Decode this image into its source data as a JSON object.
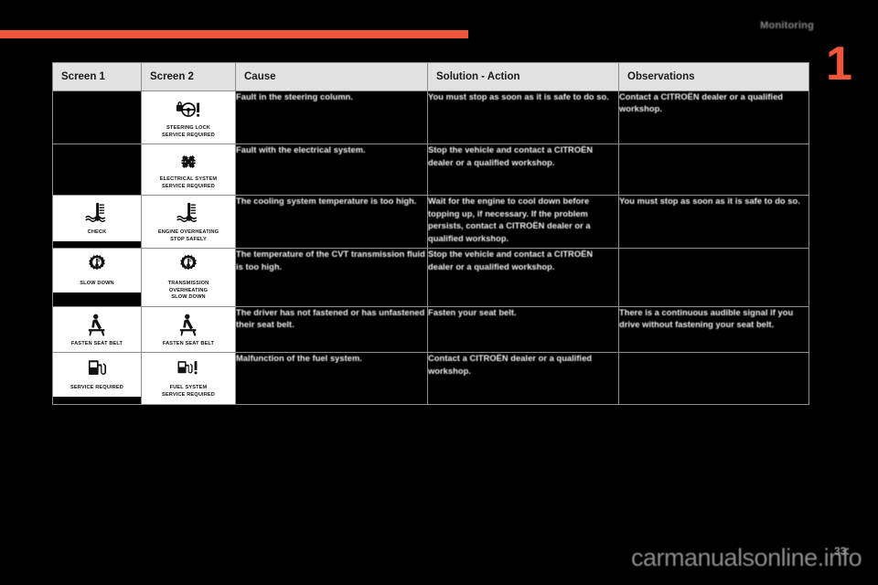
{
  "page": {
    "section_label": "Monitoring",
    "chapter_number": "1",
    "accent_color": "#F0563C",
    "header_bg": "#E2E2E2",
    "watermark": "carmanualsonline.info",
    "folio": "33"
  },
  "table": {
    "columns": [
      "Screen 1",
      "Screen 2",
      "Cause",
      "Solution - Action",
      "Observations"
    ],
    "rows": [
      {
        "screen1": null,
        "screen2": {
          "icon": "steering-lock-icon",
          "caption": "STEERING LOCK\nSERVICE REQUIRED"
        },
        "cause": "Fault in the steering column.",
        "solution": "You must stop as soon as it is safe to do so.",
        "observations": "Contact a CITROËN dealer or a qualified workshop."
      },
      {
        "screen1": null,
        "screen2": {
          "icon": "electrical-system-icon",
          "caption": "ELECTRICAL SYSTEM\nSERVICE REQUIRED"
        },
        "cause": "Fault with the electrical system.",
        "solution": "Stop the vehicle and contact a CITROËN dealer or a qualified workshop.",
        "observations": ""
      },
      {
        "screen1": {
          "icon": "coolant-temperature-icon",
          "caption": "CHECK"
        },
        "screen2": {
          "icon": "coolant-temperature-icon",
          "caption": "ENGINE OVERHEATING\nSTOP SAFELY"
        },
        "cause": "The cooling system temperature is too high.",
        "solution": "Wait for the engine to cool down before topping up, if necessary. If the problem persists, contact a CITROËN dealer or a qualified workshop.",
        "observations": "You must stop as soon as it is safe to do so."
      },
      {
        "screen1": {
          "icon": "transmission-overheating-icon",
          "caption": "SLOW DOWN"
        },
        "screen2": {
          "icon": "transmission-overheating-icon",
          "caption": "TRANSMISSION\nOVERHEATING\nSLOW DOWN"
        },
        "cause": "The temperature of the CVT transmission fluid is too high.",
        "solution": "Stop the vehicle and contact a CITROËN dealer or a qualified workshop.",
        "observations": ""
      },
      {
        "screen1": {
          "icon": "seat-belt-icon",
          "caption": "FASTEN SEAT BELT"
        },
        "screen2": {
          "icon": "seat-belt-icon",
          "caption": "FASTEN SEAT BELT"
        },
        "cause": "The driver has not fastened or has unfastened their seat belt.",
        "solution": "Fasten your seat belt.",
        "observations": "There is a continuous audible signal if you drive without fastening your seat belt."
      },
      {
        "screen1": {
          "icon": "fuel-pump-icon",
          "caption": "SERVICE REQUIRED"
        },
        "screen2": {
          "icon": "fuel-system-icon",
          "caption": "FUEL SYSTEM\nSERVICE REQUIRED"
        },
        "cause": "Malfunction of the fuel system.",
        "solution": "Contact a CITROËN dealer or a qualified workshop.",
        "observations": ""
      }
    ]
  }
}
